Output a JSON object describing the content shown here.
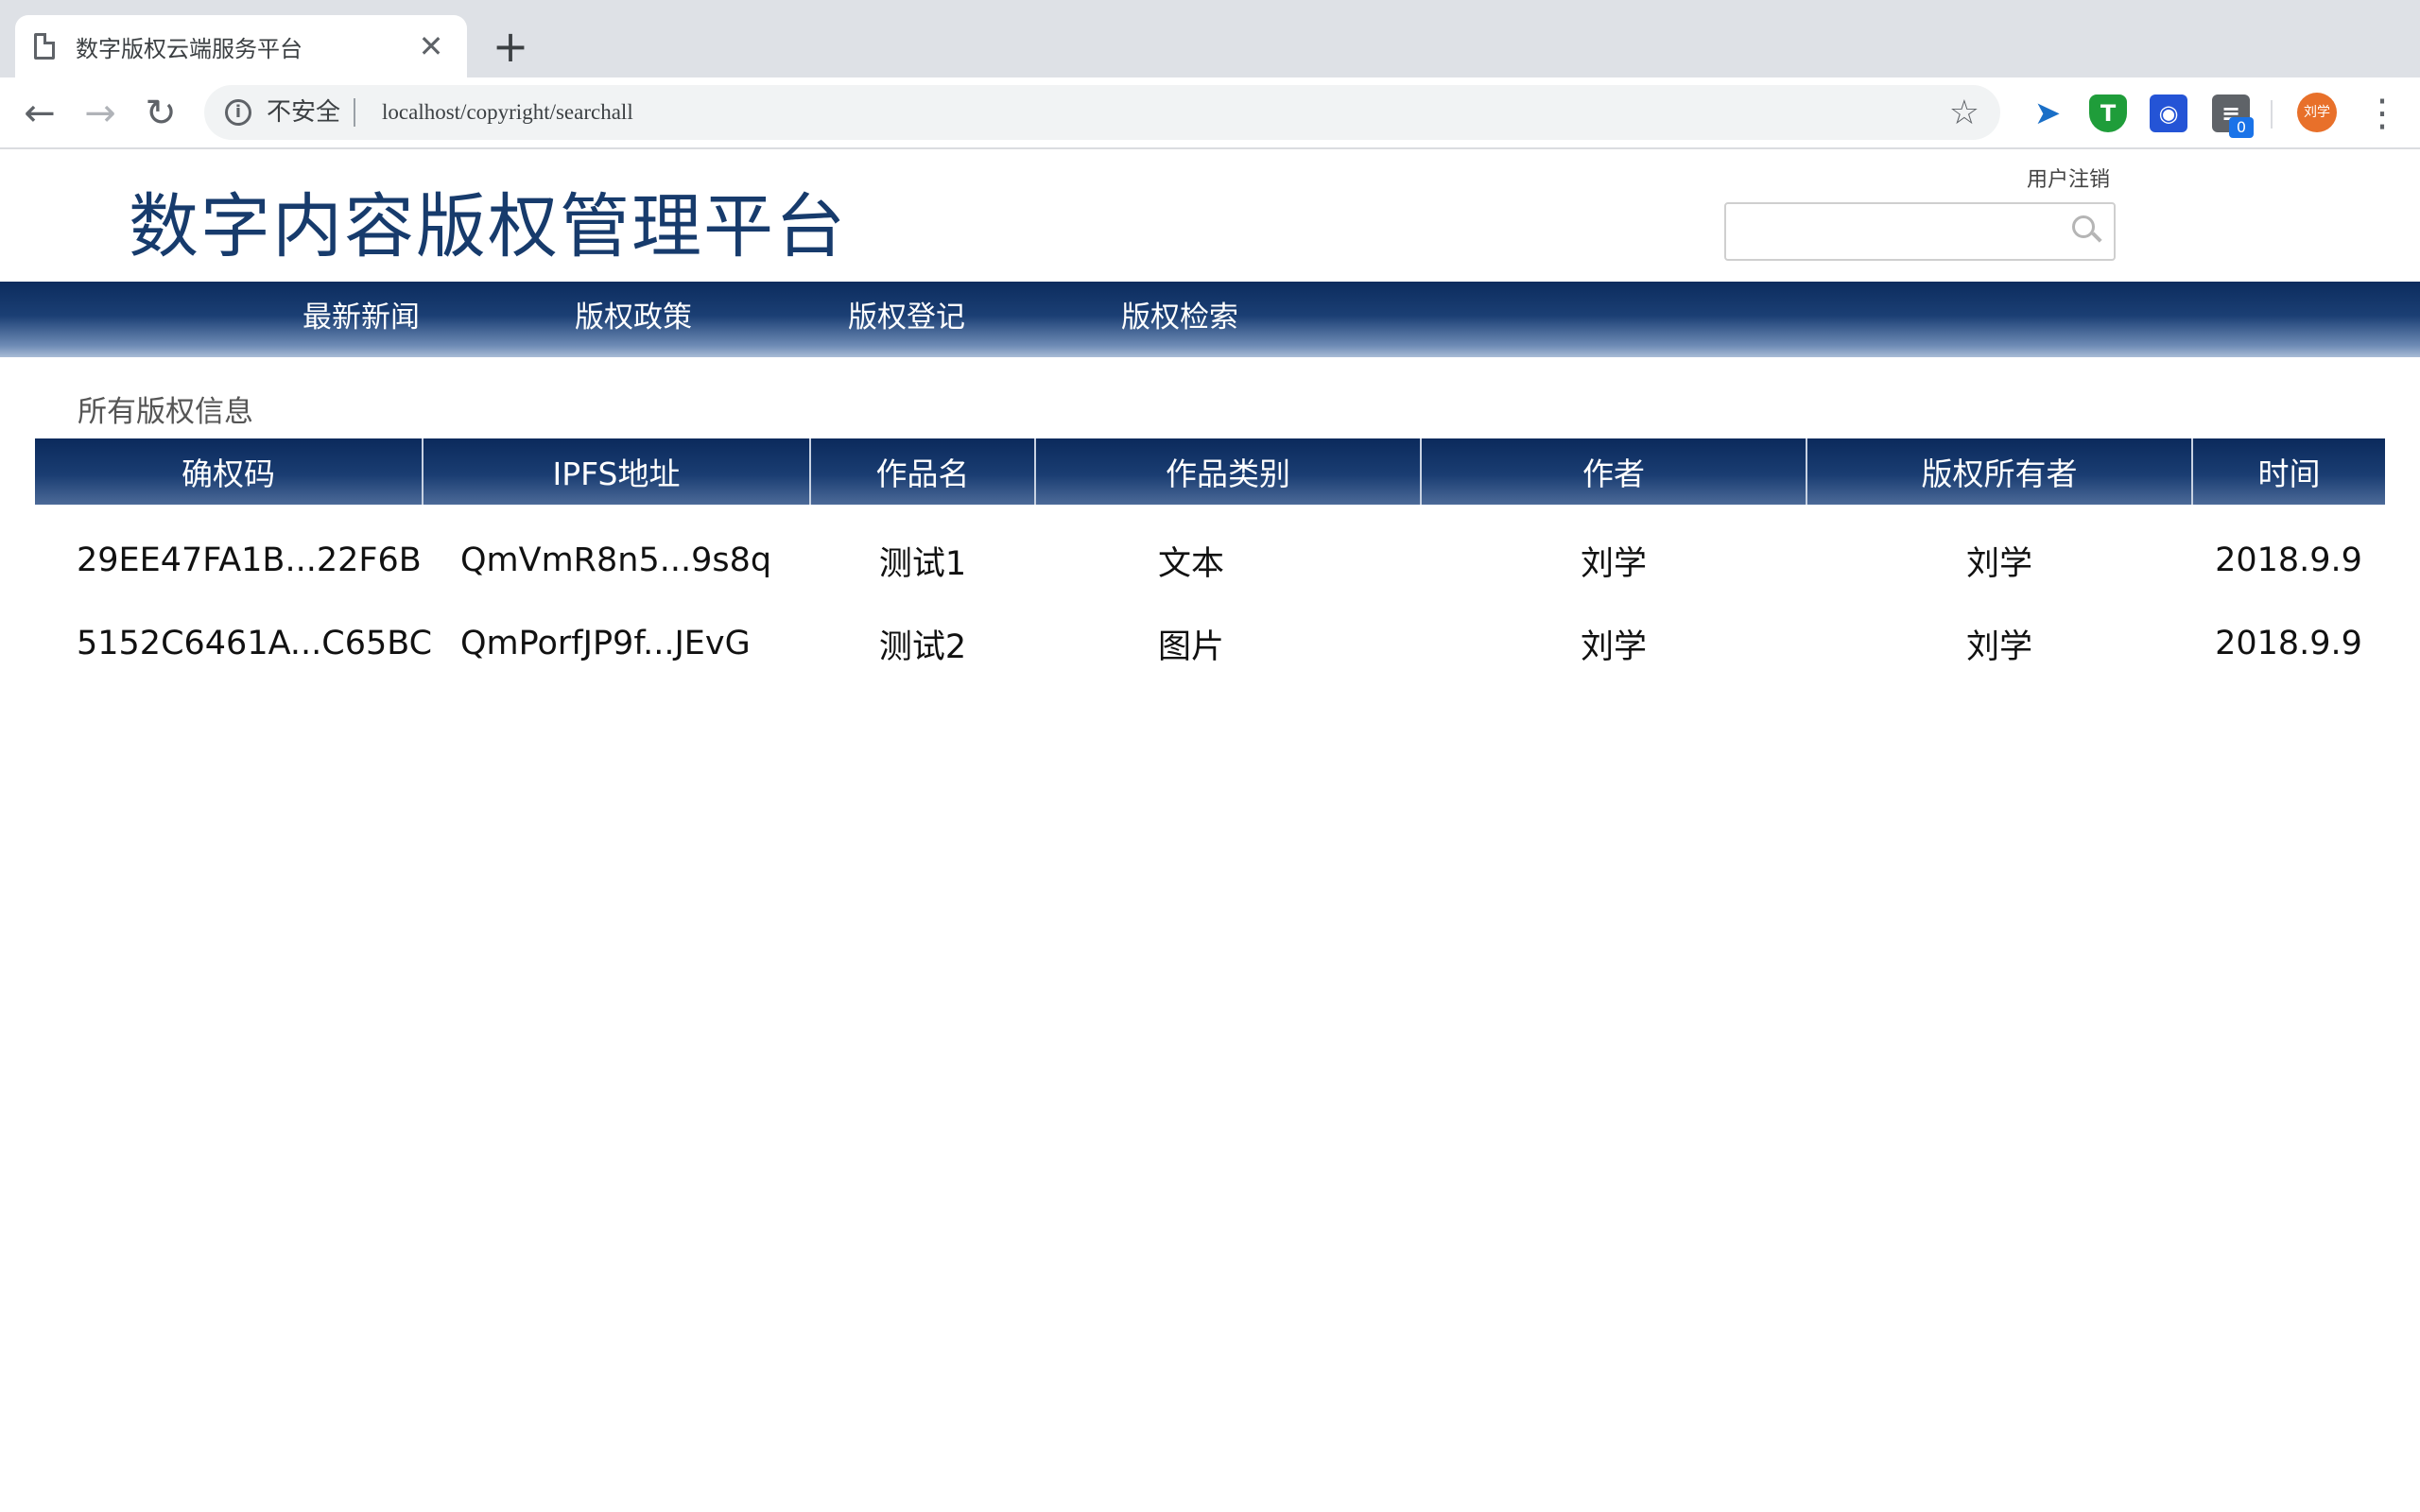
{
  "browser": {
    "tab_title": "数字版权云端服务平台",
    "tab_close": "✕",
    "new_tab": "+",
    "security_label": "不安全",
    "url": "localhost/copyright/searchall",
    "extension_badge": "0",
    "profile_name": "刘学",
    "icons": [
      "page-icon",
      "back-icon",
      "forward-icon",
      "reload-icon",
      "info-icon",
      "star-icon",
      "bird-extension-icon",
      "shield-extension-icon",
      "paw-extension-icon",
      "reader-extension-icon",
      "menu-icon"
    ]
  },
  "header": {
    "site_title": "数字内容版权管理平台",
    "logout_link": "用户注销",
    "search_value": ""
  },
  "nav": {
    "items": [
      "最新新闻",
      "版权政策",
      "版权登记",
      "版权检索"
    ]
  },
  "main": {
    "section_title": "所有版权信息",
    "columns": [
      "确权码",
      "IPFS地址",
      "作品名",
      "作品类别",
      "作者",
      "版权所有者",
      "时间"
    ],
    "rows": [
      [
        "29EE47FA1B...22F6B",
        "QmVmR8n5...9s8q",
        "测试1",
        "文本",
        "刘学",
        "刘学",
        "2018.9.9"
      ],
      [
        "5152C6461A...C65BC",
        "QmPorfJP9f...JEvG",
        "测试2",
        "图片",
        "刘学",
        "刘学",
        "2018.9.9"
      ]
    ]
  },
  "colors": {
    "nav_dark": "#0c2c5e",
    "title_blue": "#173b6c",
    "avatar_orange": "#e8702a"
  }
}
